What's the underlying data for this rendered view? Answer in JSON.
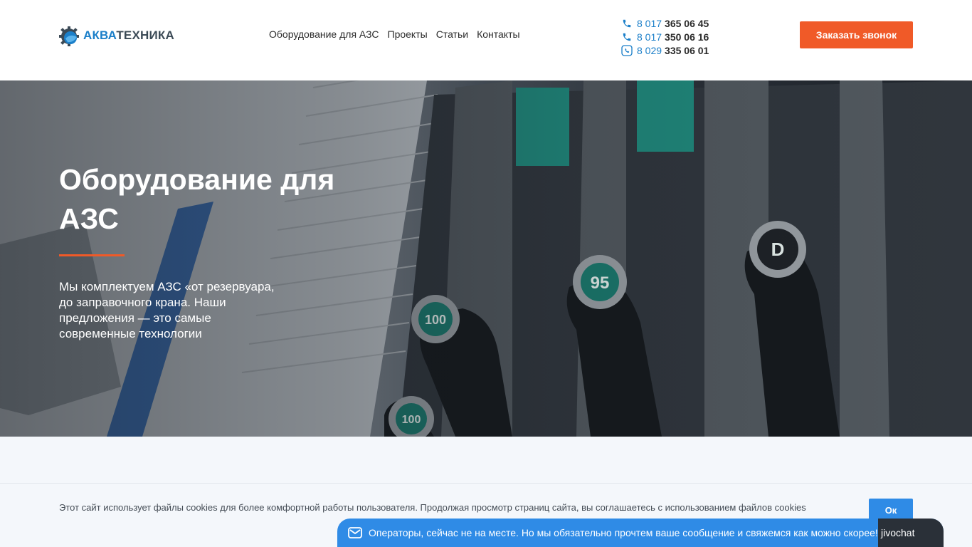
{
  "header": {
    "logo": {
      "part1": "АКВА",
      "part2": "ТЕХНИКА"
    },
    "nav": [
      "Оборудование для АЗС",
      "Проекты",
      "Статьи",
      "Контакты"
    ],
    "phones": [
      {
        "prefix": "8 017",
        "number": "365 06 45",
        "icon": "phone-icon"
      },
      {
        "prefix": "8 017",
        "number": "350 06 16",
        "icon": "phone-icon"
      },
      {
        "prefix": "8 029",
        "number": "335 06 01",
        "icon": "viber-icon"
      }
    ],
    "cta_label": "Заказать звонок"
  },
  "hero": {
    "title": "Оборудование для АЗС",
    "text": "Мы комплектуем АЗС «от резервуара, до заправочного крана. Наши предложения — это самые современные технологии",
    "nozzle_labels": [
      "100",
      "95",
      "D",
      "100"
    ]
  },
  "cookie": {
    "text": "Этот сайт использует файлы cookies для более комфортной работы пользователя. Продолжая просмотр страниц сайта, вы соглашаетесь с использованием файлов cookies",
    "ok_label": "Ок"
  },
  "chat": {
    "message": "Операторы, сейчас не на месте. Но мы обязательно прочтем ваше сообщение и свяжемся как можно скорее!",
    "brand": "jivochat"
  },
  "colors": {
    "accent": "#f05a28",
    "brand_blue": "#1b7fc9",
    "chat_blue": "#2f8be6"
  }
}
